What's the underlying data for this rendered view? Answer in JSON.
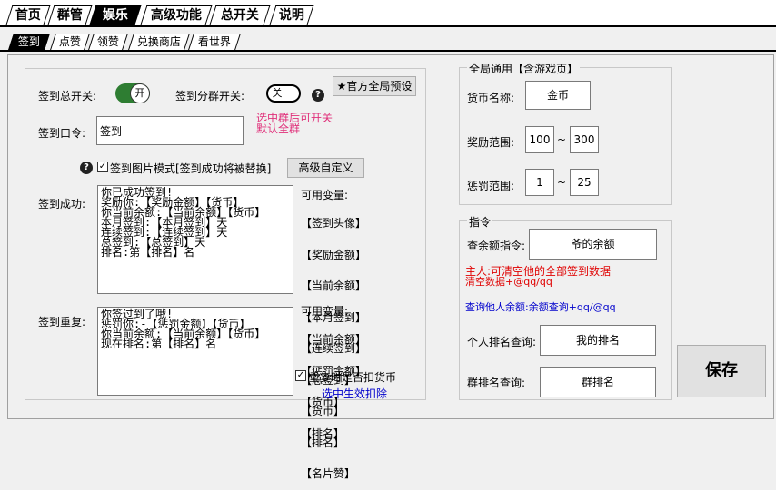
{
  "main_tabs": [
    "首页",
    "群管",
    "娱乐",
    "高级功能",
    "总开关",
    "说明"
  ],
  "sub_tabs": [
    "签到",
    "点赞",
    "领赞",
    "兑换商店",
    "看世界"
  ],
  "signin": {
    "master_switch_label": "签到总开关:",
    "master_switch_state": "开",
    "group_switch_label": "签到分群开关:",
    "group_switch_state": "关",
    "help_glyph": "?",
    "preset_button": "★官方全局预设",
    "hint_line1": "选中群后可开关",
    "hint_line2": "默认全群",
    "command_label": "签到口令:",
    "command_value": "签到",
    "image_mode_label": "签到图片模式[签到成功将被替换]",
    "advanced_button": "高级自定义",
    "success_label": "签到成功:",
    "success_text": "你已成功签到!\n奖励你:【奖励金额】【货币】\n你当前余额:【当前余额】【货币】\n本月签到:【本月签到】天\n连续签到:【连续签到】天\n总签到:【总签到】天\n排名:第【排名】名",
    "success_vars_title": "可用变量:",
    "success_vars": [
      "【签到头像】",
      "【奖励金额】",
      "【当前余额】",
      "【本月签到】",
      "【连续签到】",
      "【总签到】",
      "【货币】",
      "【排名】",
      "【名片赞】"
    ],
    "repeat_label": "签到重复:",
    "repeat_text": "你签过到了哦!\n惩罚你:-【惩罚金额】【货币】\n你当前余额:【当前余额】【货币】\n现在排名:第【排名】名",
    "repeat_vars_title": "可用变量:",
    "repeat_vars": [
      "【当前余额】",
      "【惩罚金额】",
      "【货币】",
      "【排名】"
    ],
    "deduct_label": "重复时是否扣货币",
    "deduct_hint": "选中生效扣除"
  },
  "global": {
    "title": "全局通用【含游戏页】",
    "currency_label": "货币名称:",
    "currency_value": "金币",
    "reward_label": "奖励范围:",
    "reward_min": "100",
    "reward_max": "300",
    "penalty_label": "惩罚范围:",
    "penalty_min": "1",
    "penalty_max": "25",
    "tilde": "~"
  },
  "commands": {
    "title": "指令",
    "balance_label": "查余额指令:",
    "balance_value": "爷的余额",
    "master_note1": "主人:可清空他的全部签到数据",
    "master_note2": "清空数据+@qq/qq",
    "other_note": "查询他人余额:余额查询+qq/@qq",
    "personal_rank_label": "个人排名查询:",
    "personal_rank_value": "我的排名",
    "group_rank_label": "群排名查询:",
    "group_rank_value": "群排名"
  },
  "save_button": "保存",
  "colors": {
    "hint_pink": "#e0307a",
    "master_red": "#e00000",
    "query_blue": "#0000cc"
  }
}
